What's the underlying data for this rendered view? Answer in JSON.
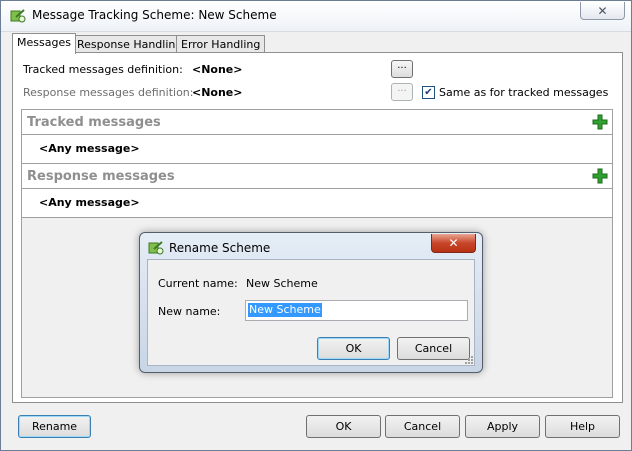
{
  "window": {
    "title": "Message Tracking Scheme: New Scheme",
    "close_label": "✕"
  },
  "tabs": [
    {
      "label": "Messages",
      "active": true
    },
    {
      "label": "Response Handling",
      "active": false
    },
    {
      "label": "Error Handling",
      "active": false
    }
  ],
  "messages_tab": {
    "tracked_def_label": "Tracked messages definition:",
    "tracked_def_value": "<None>",
    "response_def_label": "Response messages definition:",
    "response_def_value": "<None>",
    "browse_label": "...",
    "same_as_label": "Same as for tracked messages",
    "same_as_checked": true,
    "tracked_section": {
      "header": "Tracked messages",
      "row": "<Any message>"
    },
    "response_section": {
      "header": "Response messages",
      "row": "<Any message>"
    }
  },
  "footer": {
    "rename": "Rename",
    "ok": "OK",
    "cancel": "Cancel",
    "apply": "Apply",
    "help": "Help"
  },
  "rename_dialog": {
    "title": "Rename Scheme",
    "close_label": "✕",
    "current_name_label": "Current name:",
    "current_name_value": "New Scheme",
    "new_name_label": "New name:",
    "new_name_value": "New Scheme",
    "ok": "OK",
    "cancel": "Cancel"
  },
  "colors": {
    "accent_plus": "#2fa12f",
    "selection": "#3399ff",
    "disabled_header": "#8f8f8f"
  }
}
